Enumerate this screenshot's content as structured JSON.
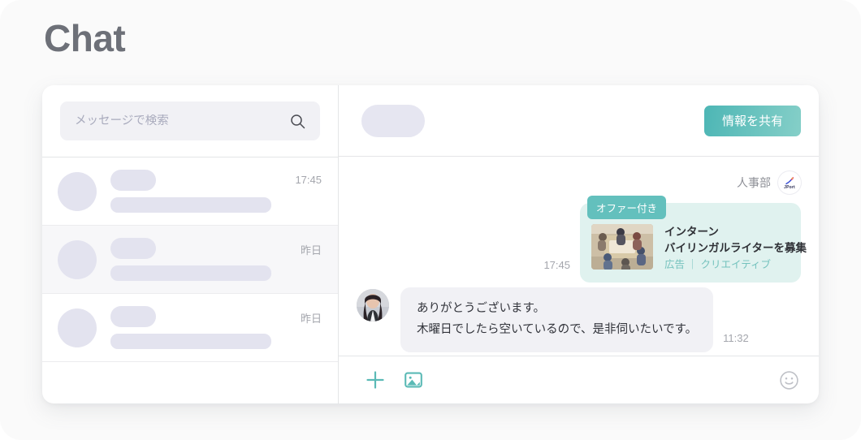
{
  "page": {
    "title": "Chat",
    "background_color": "#fafafa"
  },
  "theme": {
    "accent": "#63c0bd",
    "accent_gradient_start": "#4db6b5",
    "accent_gradient_end": "#85cfc8",
    "bubble_offer_bg": "#e0f2ef",
    "bubble_reply_bg": "#f1f1f5",
    "placeholder_block": "#e3e3ef",
    "muted_text": "#a4a6ad"
  },
  "sidebar": {
    "search": {
      "placeholder": "メッセージで検索",
      "value": "",
      "icon": "search-icon"
    },
    "conversations": [
      {
        "time": "17:45",
        "active": false
      },
      {
        "time": "昨日",
        "active": true
      },
      {
        "time": "昨日",
        "active": false
      }
    ]
  },
  "chat": {
    "header": {
      "share_button_label": "情報を共有"
    },
    "messages": [
      {
        "kind": "offer-card",
        "sender": "人事部",
        "brand_avatar_label": "JPort",
        "badge": "オファー付き",
        "time": "17:45",
        "card": {
          "thumbnail_alt": "meeting-photo",
          "line1": "インターン",
          "line2": "バイリンガルライターを募集",
          "tags": "広告 ｜ クリエイティブ"
        }
      },
      {
        "kind": "text",
        "avatar_alt": "user-photo",
        "line1": "ありがとうございます。",
        "line2": "木曜日でしたら空いているので、是非伺いたいです。",
        "time": "11:32"
      }
    ],
    "composer": {
      "attach_icon": "plus-icon",
      "image_icon": "image-icon",
      "emoji_icon": "emoji-icon"
    }
  }
}
